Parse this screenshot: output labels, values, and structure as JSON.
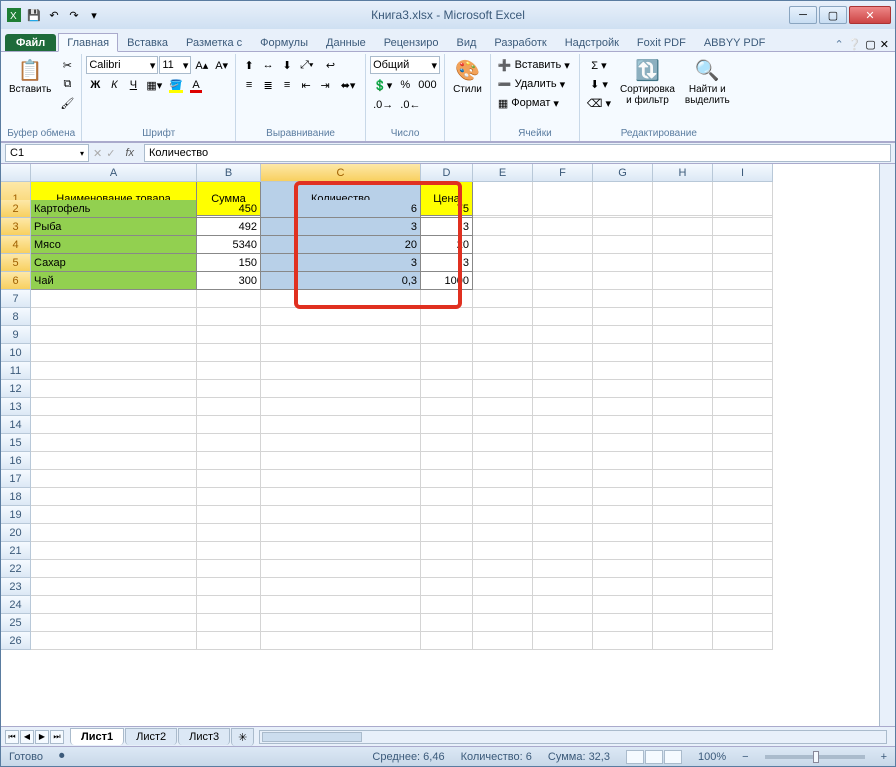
{
  "title": "Книга3.xlsx - Microsoft Excel",
  "tabs": {
    "file": "Файл",
    "home": "Главная",
    "insert": "Вставка",
    "layout": "Разметка с",
    "formulas": "Формулы",
    "data": "Данные",
    "review": "Рецензиро",
    "view": "Вид",
    "developer": "Разработк",
    "addins": "Надстройк",
    "foxit": "Foxit PDF",
    "abbyy": "ABBYY PDF"
  },
  "ribbon": {
    "clipboard": {
      "paste": "Вставить",
      "label": "Буфер обмена"
    },
    "font": {
      "name": "Calibri",
      "size": "11",
      "bold": "Ж",
      "italic": "К",
      "underline": "Ч",
      "label": "Шрифт"
    },
    "align": {
      "label": "Выравнивание"
    },
    "number": {
      "format": "Общий",
      "label": "Число"
    },
    "styles": {
      "styles": "Стили",
      "label": ""
    },
    "cells": {
      "insert": "Вставить",
      "delete": "Удалить",
      "format": "Формат",
      "label": "Ячейки"
    },
    "editing": {
      "sort": "Сортировка\nи фильтр",
      "find": "Найти и\nвыделить",
      "label": "Редактирование"
    }
  },
  "name_box": "C1",
  "formula": "Количество",
  "columns": [
    "A",
    "B",
    "C",
    "D",
    "E",
    "F",
    "G",
    "H",
    "I"
  ],
  "rows": [
    "1",
    "2",
    "3",
    "4",
    "5",
    "6",
    "7",
    "8",
    "9",
    "10",
    "11",
    "12",
    "13",
    "14",
    "15",
    "16",
    "17",
    "18",
    "19",
    "20",
    "21",
    "22",
    "23",
    "24",
    "25",
    "26"
  ],
  "headers": {
    "a": "Наименование товара",
    "b": "Сумма",
    "c": "Количество",
    "d": "Цена"
  },
  "data": [
    {
      "name": "Картофель",
      "sum": "450",
      "qty": "6",
      "price": "75"
    },
    {
      "name": "Рыба",
      "sum": "492",
      "qty": "3",
      "price": "3"
    },
    {
      "name": "Мясо",
      "sum": "5340",
      "qty": "20",
      "price": "20"
    },
    {
      "name": "Сахар",
      "sum": "150",
      "qty": "3",
      "price": "3"
    },
    {
      "name": "Чай",
      "sum": "300",
      "qty": "0,3",
      "price": "1000"
    }
  ],
  "sheets": {
    "s1": "Лист1",
    "s2": "Лист2",
    "s3": "Лист3"
  },
  "status": {
    "ready": "Готово",
    "avg": "Среднее: 6,46",
    "count": "Количество: 6",
    "sum": "Сумма: 32,3",
    "zoom": "100%"
  }
}
